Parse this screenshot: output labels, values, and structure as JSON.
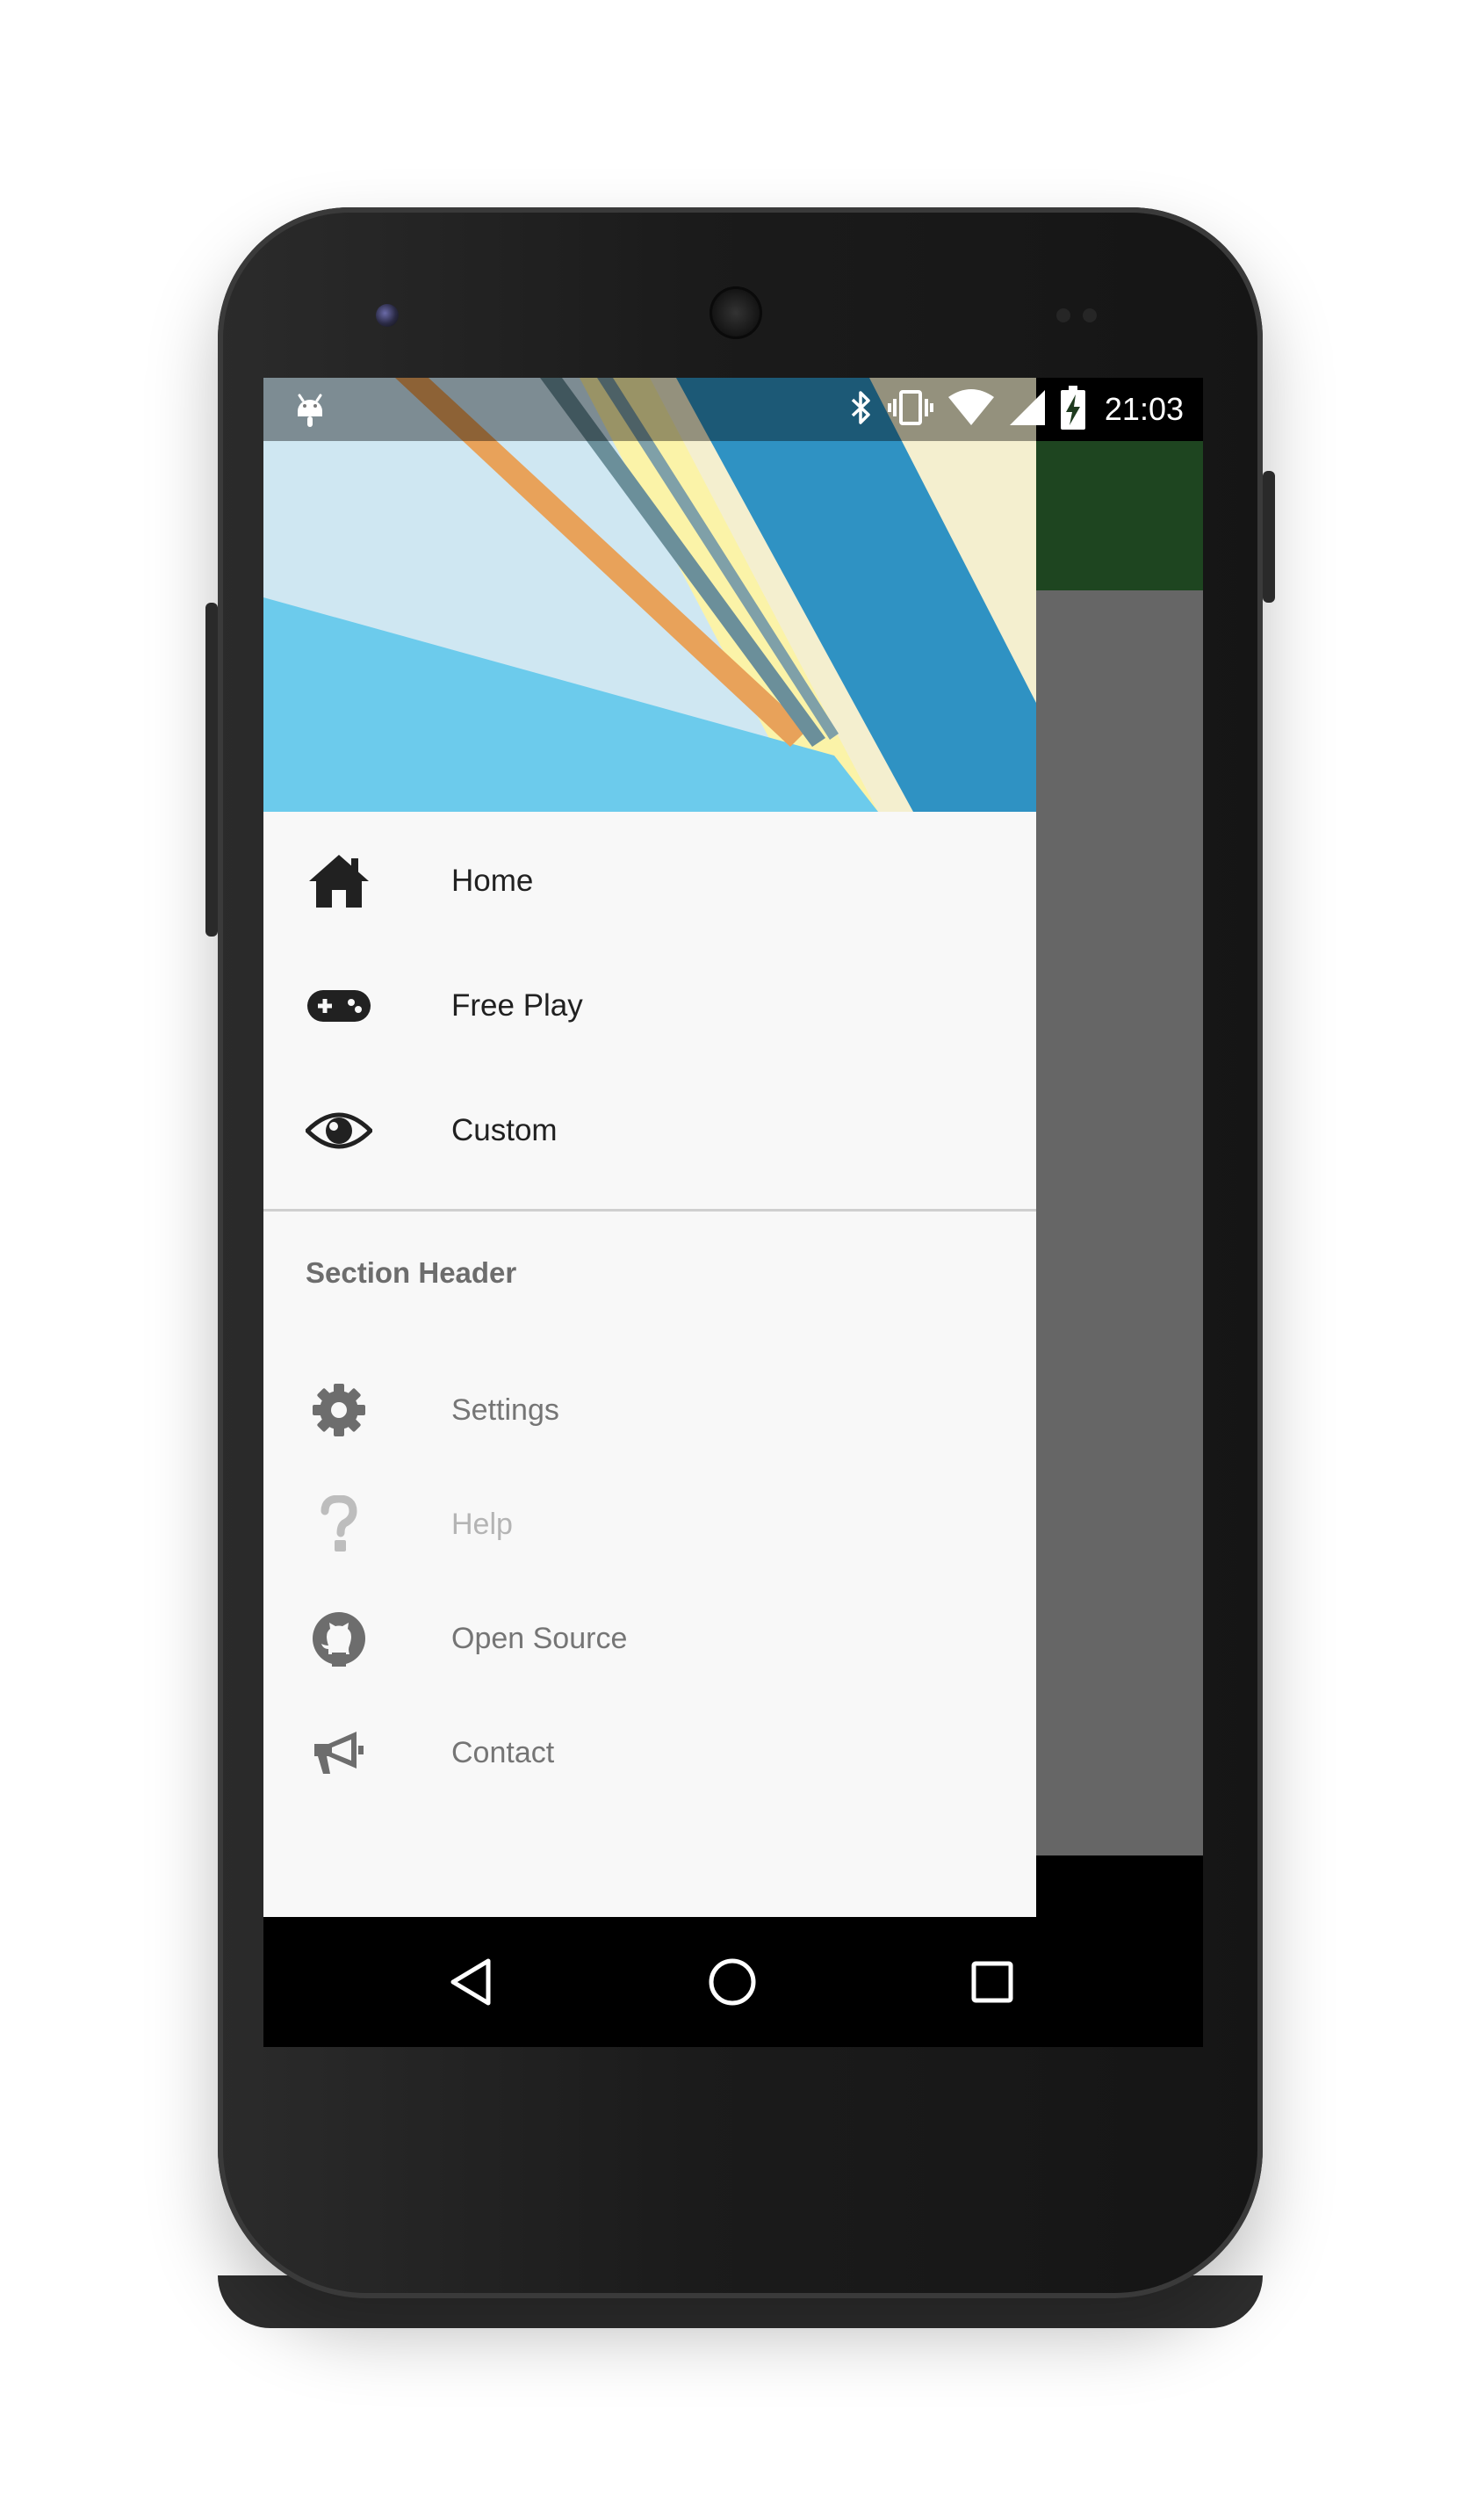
{
  "status_bar": {
    "time": "21:03",
    "icons": [
      "android-debug-icon",
      "bluetooth-icon",
      "vibrate-icon",
      "wifi-icon",
      "cell-signal-icon",
      "battery-charging-icon"
    ]
  },
  "drawer": {
    "primary_items": [
      {
        "label": "Home",
        "icon": "home-icon"
      },
      {
        "label": "Free Play",
        "icon": "gamepad-icon"
      },
      {
        "label": "Custom",
        "icon": "eye-icon"
      }
    ],
    "section_header": "Section Header",
    "secondary_items": [
      {
        "label": "Settings",
        "icon": "gear-icon",
        "enabled": true
      },
      {
        "label": "Help",
        "icon": "question-icon",
        "enabled": false
      },
      {
        "label": "Open Source",
        "icon": "github-icon",
        "enabled": true
      },
      {
        "label": "Contact",
        "icon": "megaphone-icon",
        "enabled": true
      }
    ]
  },
  "nav_bar": {
    "buttons": [
      "back-icon",
      "home-circle-icon",
      "recents-icon"
    ]
  },
  "colors": {
    "app_bar": "#1e4520",
    "scrim": "#666666",
    "drawer_bg": "#f8f8f8",
    "primary_text": "#212121",
    "secondary_text": "#757575",
    "disabled_text": "#b4b4b4"
  }
}
